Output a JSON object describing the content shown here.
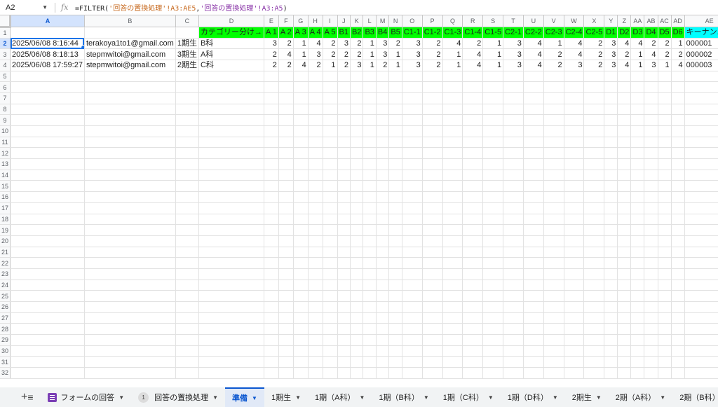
{
  "formula_bar": {
    "cell_ref": "A2",
    "fx": "fx",
    "formula_parts": [
      "=FILTER(",
      "'回答の置換処理'!A3:AE5",
      ",",
      "'回答の置換処理'!A3:A5",
      ")"
    ]
  },
  "columns": [
    "A",
    "B",
    "C",
    "D",
    "E",
    "F",
    "G",
    "H",
    "I",
    "J",
    "K",
    "L",
    "M",
    "N",
    "O",
    "P",
    "Q",
    "R",
    "S",
    "T",
    "U",
    "V",
    "W",
    "X",
    "Y",
    "Z",
    "AA",
    "AB",
    "AC",
    "AD",
    "AE"
  ],
  "header_row": [
    "",
    "",
    "",
    "カテゴリー分け→",
    "A 1",
    "A 2",
    "A 3",
    "A 4",
    "A 5",
    "B1",
    "B2",
    "B3",
    "B4",
    "B5",
    "C1-1",
    "C1-2",
    "C1-3",
    "C1-4",
    "C1-5",
    "C2-1",
    "C2-2",
    "C2-3",
    "C2-4",
    "C2-5",
    "D1",
    "D2",
    "D3",
    "D4",
    "D5",
    "D6",
    "キーナンバー"
  ],
  "rows": [
    [
      "2025/06/08 8:16:44",
      "terakoya1to1@gmail.com",
      "1期生",
      "B科",
      "3",
      "2",
      "1",
      "4",
      "2",
      "3",
      "2",
      "1",
      "3",
      "2",
      "3",
      "2",
      "4",
      "2",
      "1",
      "3",
      "4",
      "1",
      "4",
      "2",
      "3",
      "4",
      "4",
      "2",
      "2",
      "1",
      "000001"
    ],
    [
      "2025/06/08 8:18:13",
      "stepmwitoi@gmail.com",
      "3期生",
      "A科",
      "2",
      "4",
      "1",
      "3",
      "2",
      "2",
      "2",
      "1",
      "3",
      "1",
      "3",
      "2",
      "1",
      "4",
      "1",
      "3",
      "4",
      "2",
      "4",
      "2",
      "3",
      "2",
      "1",
      "4",
      "2",
      "2",
      "000002"
    ],
    [
      "2025/06/08 17:59:27",
      "stepmwitoi@gmail.com",
      "2期生",
      "C科",
      "2",
      "2",
      "4",
      "2",
      "1",
      "2",
      "3",
      "1",
      "2",
      "1",
      "3",
      "2",
      "1",
      "4",
      "1",
      "3",
      "4",
      "2",
      "3",
      "2",
      "3",
      "4",
      "1",
      "3",
      "1",
      "4",
      "000003"
    ]
  ],
  "total_rows": 32,
  "tabs": {
    "add_icon": "plus-icon",
    "menu_icon": "hamburger-icon",
    "items": [
      {
        "label": "フォームの回答",
        "icon": "form-icon"
      },
      {
        "label": "回答の置換処理",
        "badge": "1"
      },
      {
        "label": "準備",
        "active": true
      },
      {
        "label": "1期生"
      },
      {
        "label": "1期（A科）"
      },
      {
        "label": "1期（B科）"
      },
      {
        "label": "1期（C科）"
      },
      {
        "label": "1期（D科）"
      },
      {
        "label": "2期生"
      },
      {
        "label": "2期（A科）"
      },
      {
        "label": "2期（B科）"
      }
    ]
  },
  "colors": {
    "header_green": "#00ff00",
    "key_cyan": "#00ffff",
    "selection": "#1a73e8"
  }
}
